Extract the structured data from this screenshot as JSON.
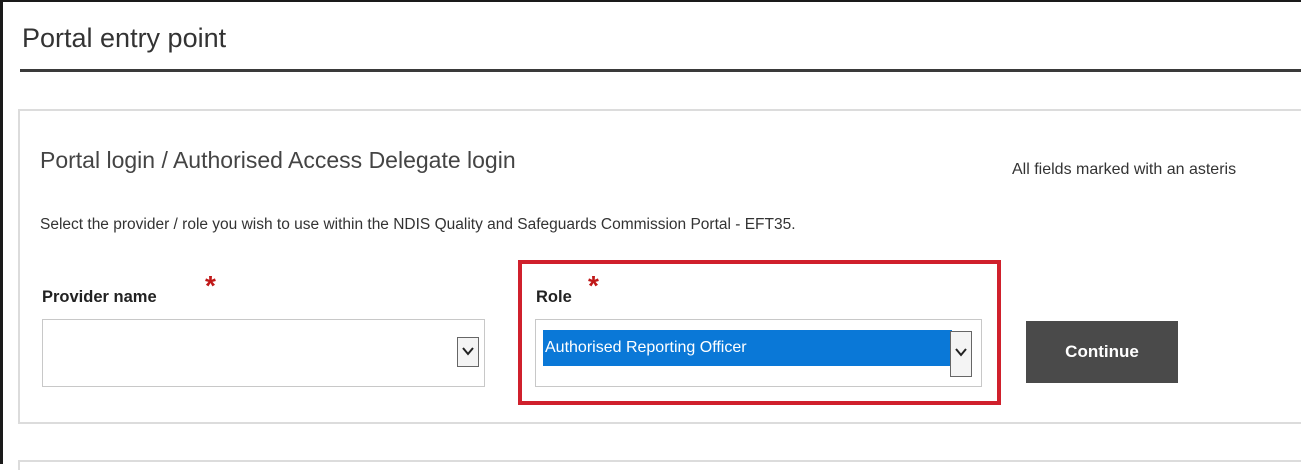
{
  "page": {
    "title": "Portal entry point"
  },
  "login_panel": {
    "heading": "Portal login / Authorised Access Delegate login",
    "asterisk_note": "All fields marked with an asteris",
    "instruction": "Select the provider / role you wish to use within the NDIS Quality and Safeguards Commission Portal - EFT35.",
    "required_marker": "*",
    "provider_field": {
      "label": "Provider name",
      "value": ""
    },
    "role_field": {
      "label": "Role",
      "value": "Authorised Reporting Officer"
    },
    "continue_label": "Continue"
  },
  "colors": {
    "highlight_border": "#d0202c",
    "selected_value_bg": "#0a78d7",
    "required_star": "#c01818",
    "continue_button_bg": "#4a4a4a"
  },
  "icons": {
    "dropdown": "chevron-down-icon"
  }
}
